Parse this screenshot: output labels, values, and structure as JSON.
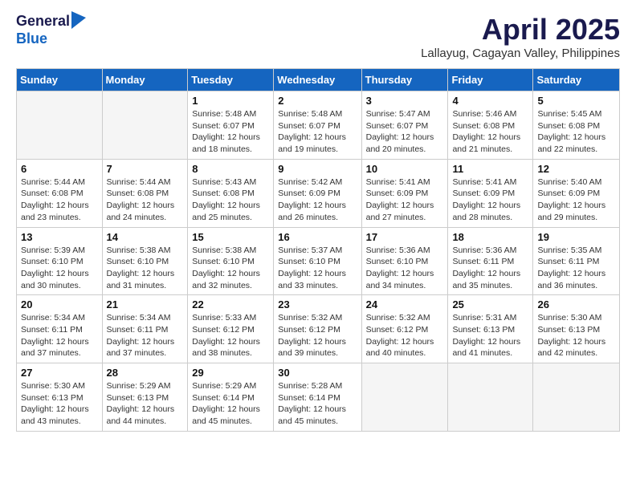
{
  "header": {
    "logo_line1": "General",
    "logo_line2": "Blue",
    "main_title": "April 2025",
    "subtitle": "Lallayug, Cagayan Valley, Philippines"
  },
  "days_of_week": [
    "Sunday",
    "Monday",
    "Tuesday",
    "Wednesday",
    "Thursday",
    "Friday",
    "Saturday"
  ],
  "weeks": [
    [
      {
        "day": "",
        "empty": true
      },
      {
        "day": "",
        "empty": true
      },
      {
        "day": "1",
        "sunrise": "Sunrise: 5:48 AM",
        "sunset": "Sunset: 6:07 PM",
        "daylight": "Daylight: 12 hours and 18 minutes."
      },
      {
        "day": "2",
        "sunrise": "Sunrise: 5:48 AM",
        "sunset": "Sunset: 6:07 PM",
        "daylight": "Daylight: 12 hours and 19 minutes."
      },
      {
        "day": "3",
        "sunrise": "Sunrise: 5:47 AM",
        "sunset": "Sunset: 6:07 PM",
        "daylight": "Daylight: 12 hours and 20 minutes."
      },
      {
        "day": "4",
        "sunrise": "Sunrise: 5:46 AM",
        "sunset": "Sunset: 6:08 PM",
        "daylight": "Daylight: 12 hours and 21 minutes."
      },
      {
        "day": "5",
        "sunrise": "Sunrise: 5:45 AM",
        "sunset": "Sunset: 6:08 PM",
        "daylight": "Daylight: 12 hours and 22 minutes."
      }
    ],
    [
      {
        "day": "6",
        "sunrise": "Sunrise: 5:44 AM",
        "sunset": "Sunset: 6:08 PM",
        "daylight": "Daylight: 12 hours and 23 minutes."
      },
      {
        "day": "7",
        "sunrise": "Sunrise: 5:44 AM",
        "sunset": "Sunset: 6:08 PM",
        "daylight": "Daylight: 12 hours and 24 minutes."
      },
      {
        "day": "8",
        "sunrise": "Sunrise: 5:43 AM",
        "sunset": "Sunset: 6:08 PM",
        "daylight": "Daylight: 12 hours and 25 minutes."
      },
      {
        "day": "9",
        "sunrise": "Sunrise: 5:42 AM",
        "sunset": "Sunset: 6:09 PM",
        "daylight": "Daylight: 12 hours and 26 minutes."
      },
      {
        "day": "10",
        "sunrise": "Sunrise: 5:41 AM",
        "sunset": "Sunset: 6:09 PM",
        "daylight": "Daylight: 12 hours and 27 minutes."
      },
      {
        "day": "11",
        "sunrise": "Sunrise: 5:41 AM",
        "sunset": "Sunset: 6:09 PM",
        "daylight": "Daylight: 12 hours and 28 minutes."
      },
      {
        "day": "12",
        "sunrise": "Sunrise: 5:40 AM",
        "sunset": "Sunset: 6:09 PM",
        "daylight": "Daylight: 12 hours and 29 minutes."
      }
    ],
    [
      {
        "day": "13",
        "sunrise": "Sunrise: 5:39 AM",
        "sunset": "Sunset: 6:10 PM",
        "daylight": "Daylight: 12 hours and 30 minutes."
      },
      {
        "day": "14",
        "sunrise": "Sunrise: 5:38 AM",
        "sunset": "Sunset: 6:10 PM",
        "daylight": "Daylight: 12 hours and 31 minutes."
      },
      {
        "day": "15",
        "sunrise": "Sunrise: 5:38 AM",
        "sunset": "Sunset: 6:10 PM",
        "daylight": "Daylight: 12 hours and 32 minutes."
      },
      {
        "day": "16",
        "sunrise": "Sunrise: 5:37 AM",
        "sunset": "Sunset: 6:10 PM",
        "daylight": "Daylight: 12 hours and 33 minutes."
      },
      {
        "day": "17",
        "sunrise": "Sunrise: 5:36 AM",
        "sunset": "Sunset: 6:10 PM",
        "daylight": "Daylight: 12 hours and 34 minutes."
      },
      {
        "day": "18",
        "sunrise": "Sunrise: 5:36 AM",
        "sunset": "Sunset: 6:11 PM",
        "daylight": "Daylight: 12 hours and 35 minutes."
      },
      {
        "day": "19",
        "sunrise": "Sunrise: 5:35 AM",
        "sunset": "Sunset: 6:11 PM",
        "daylight": "Daylight: 12 hours and 36 minutes."
      }
    ],
    [
      {
        "day": "20",
        "sunrise": "Sunrise: 5:34 AM",
        "sunset": "Sunset: 6:11 PM",
        "daylight": "Daylight: 12 hours and 37 minutes."
      },
      {
        "day": "21",
        "sunrise": "Sunrise: 5:34 AM",
        "sunset": "Sunset: 6:11 PM",
        "daylight": "Daylight: 12 hours and 37 minutes."
      },
      {
        "day": "22",
        "sunrise": "Sunrise: 5:33 AM",
        "sunset": "Sunset: 6:12 PM",
        "daylight": "Daylight: 12 hours and 38 minutes."
      },
      {
        "day": "23",
        "sunrise": "Sunrise: 5:32 AM",
        "sunset": "Sunset: 6:12 PM",
        "daylight": "Daylight: 12 hours and 39 minutes."
      },
      {
        "day": "24",
        "sunrise": "Sunrise: 5:32 AM",
        "sunset": "Sunset: 6:12 PM",
        "daylight": "Daylight: 12 hours and 40 minutes."
      },
      {
        "day": "25",
        "sunrise": "Sunrise: 5:31 AM",
        "sunset": "Sunset: 6:13 PM",
        "daylight": "Daylight: 12 hours and 41 minutes."
      },
      {
        "day": "26",
        "sunrise": "Sunrise: 5:30 AM",
        "sunset": "Sunset: 6:13 PM",
        "daylight": "Daylight: 12 hours and 42 minutes."
      }
    ],
    [
      {
        "day": "27",
        "sunrise": "Sunrise: 5:30 AM",
        "sunset": "Sunset: 6:13 PM",
        "daylight": "Daylight: 12 hours and 43 minutes."
      },
      {
        "day": "28",
        "sunrise": "Sunrise: 5:29 AM",
        "sunset": "Sunset: 6:13 PM",
        "daylight": "Daylight: 12 hours and 44 minutes."
      },
      {
        "day": "29",
        "sunrise": "Sunrise: 5:29 AM",
        "sunset": "Sunset: 6:14 PM",
        "daylight": "Daylight: 12 hours and 45 minutes."
      },
      {
        "day": "30",
        "sunrise": "Sunrise: 5:28 AM",
        "sunset": "Sunset: 6:14 PM",
        "daylight": "Daylight: 12 hours and 45 minutes."
      },
      {
        "day": "",
        "empty": true
      },
      {
        "day": "",
        "empty": true
      },
      {
        "day": "",
        "empty": true
      }
    ]
  ]
}
